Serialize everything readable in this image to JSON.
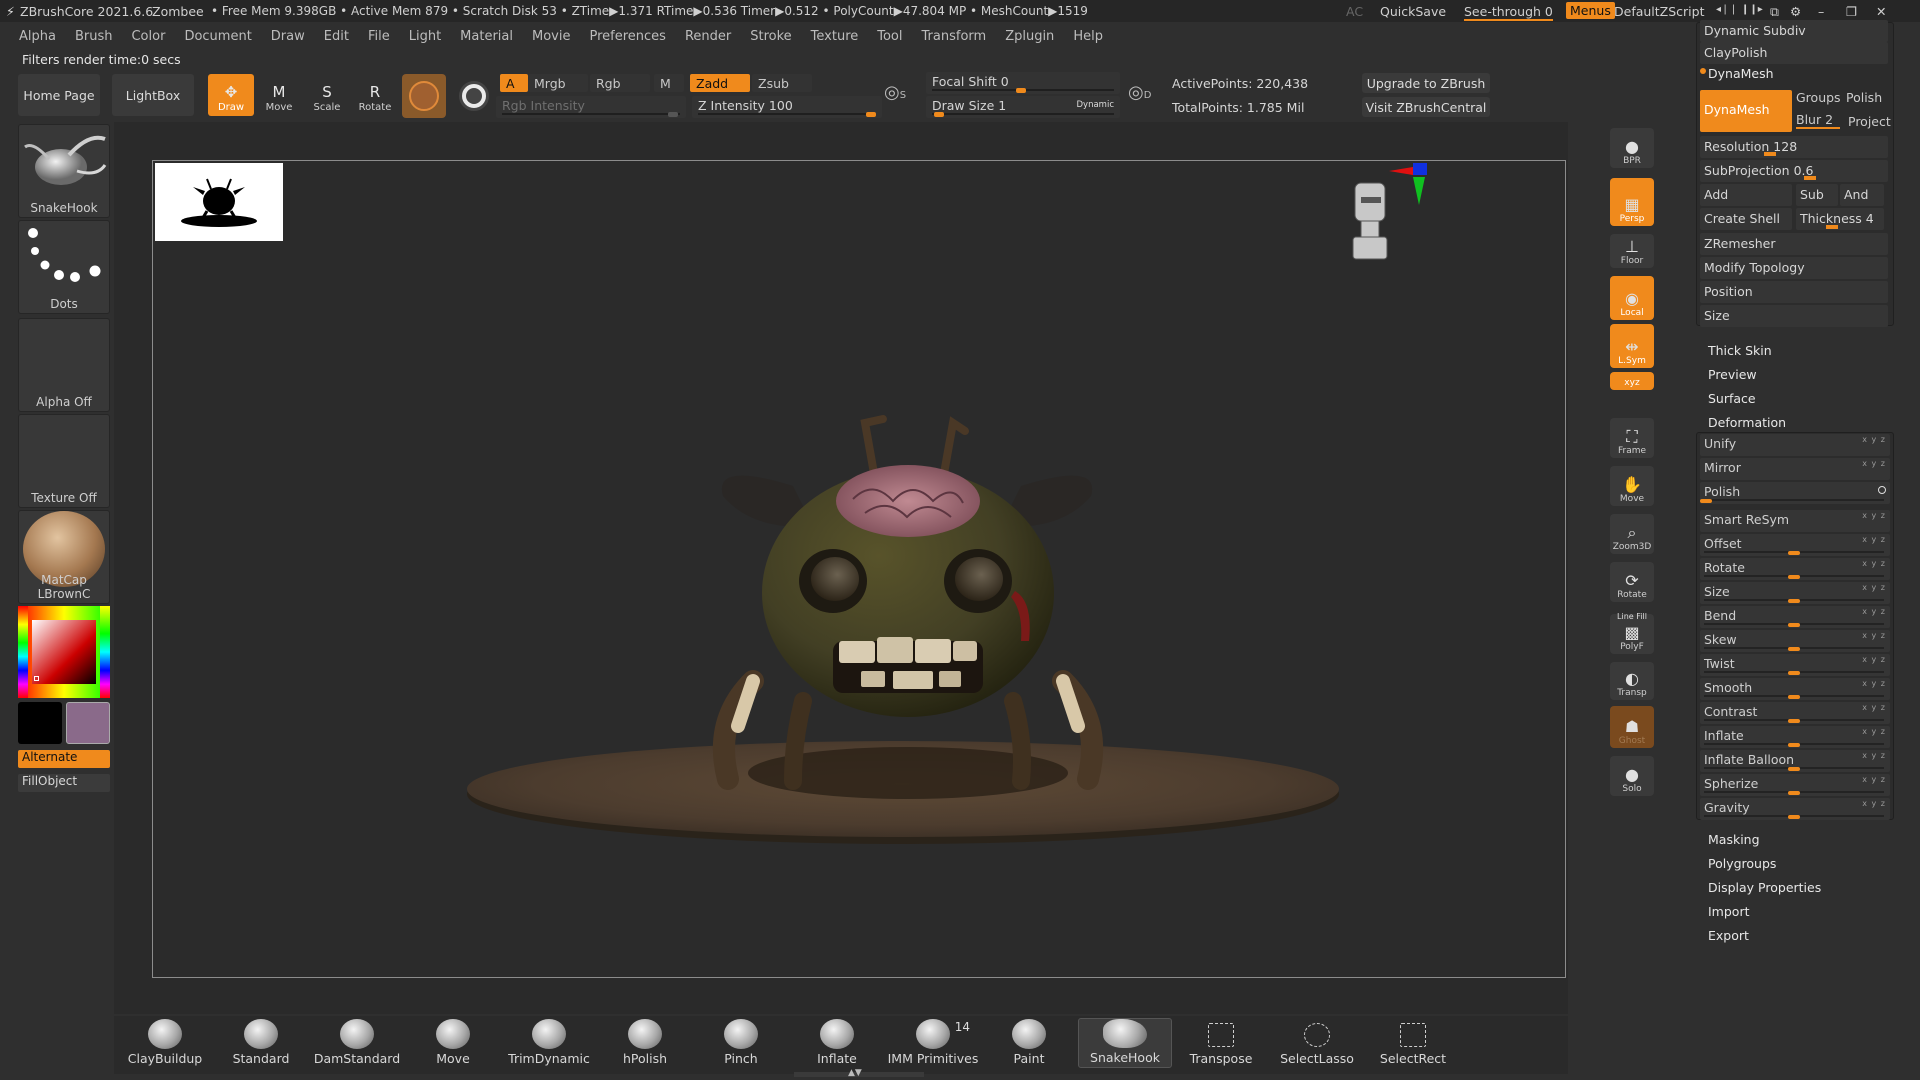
{
  "titlebar": {
    "app": "ZBrushCore 2021.6.6",
    "project": "Zombee",
    "stats": "• Free Mem 9.398GB • Active Mem 879 • Scratch Disk 53 • ZTime▶1.371 RTime▶0.536 Timer▶0.512 • PolyCount▶47.804 MP • MeshCount▶1519",
    "ac": "AC",
    "quicksave": "QuickSave",
    "seethrough": "See-through  0",
    "menus": "Menus",
    "script": "DefaultZScript"
  },
  "menu": [
    "Alpha",
    "Brush",
    "Color",
    "Document",
    "Draw",
    "Edit",
    "File",
    "Light",
    "Material",
    "Movie",
    "Preferences",
    "Render",
    "Stroke",
    "Texture",
    "Tool",
    "Transform",
    "Zplugin",
    "Help"
  ],
  "notice": "Filters render time:0 secs",
  "toolbar": {
    "home": "Home Page",
    "lightbox": "LightBox",
    "tools": [
      {
        "icon": "draw-icon",
        "glyph": "✥",
        "label": "Draw",
        "on": true
      },
      {
        "icon": "move-icon",
        "glyph": "M",
        "label": "Move",
        "on": false
      },
      {
        "icon": "scale-icon",
        "glyph": "S",
        "label": "Scale",
        "on": false
      },
      {
        "icon": "rotate-icon",
        "glyph": "R",
        "label": "Rotate",
        "on": false
      }
    ],
    "a": "A",
    "mrgb": "Mrgb",
    "rgb": "Rgb",
    "m": "M",
    "rgb_intensity": "Rgb Intensity",
    "zadd": "Zadd",
    "zsub": "Zsub",
    "z_intensity": "Z Intensity 100",
    "z_intensity_value": 100,
    "focal_shift": "Focal Shift 0",
    "focal_shift_value": 0,
    "draw_size": "Draw Size 1",
    "draw_size_value": 1,
    "dynamic": "Dynamic",
    "s_label": "S",
    "d_label": "D",
    "active_points": "ActivePoints: 220,438",
    "total_points": "TotalPoints: 1.785 Mil",
    "upgrade": "Upgrade to ZBrush",
    "visit": "Visit ZBrushCentral"
  },
  "left_shelf": {
    "brush": "SnakeHook",
    "stroke": "Dots",
    "alpha": "Alpha Off",
    "texture": "Texture Off",
    "material": "MatCap LBrownC",
    "alternate": "Alternate",
    "fillobject": "FillObject",
    "colors": {
      "primary": "#000000",
      "secondary": "#8a6a8a"
    }
  },
  "right_shelf": [
    {
      "label": "BPR",
      "icon": "bpr-icon",
      "glyph": "●",
      "on": false
    },
    {
      "label": "Persp",
      "icon": "perspective-icon",
      "glyph": "▦",
      "on": true
    },
    {
      "label": "Floor",
      "icon": "floor-icon",
      "glyph": "⊥",
      "on": false
    },
    {
      "label": "Local",
      "icon": "local-icon",
      "glyph": "◉",
      "on": true
    },
    {
      "label": "L.Sym",
      "icon": "local-symmetry-icon",
      "glyph": "⇹",
      "on": true
    },
    {
      "label": "xyz",
      "icon": "xyz-icon",
      "glyph": "",
      "on": true
    },
    {
      "label": "Frame",
      "icon": "frame-icon",
      "glyph": "⛶",
      "on": false
    },
    {
      "label": "Move",
      "icon": "hand-icon",
      "glyph": "✋",
      "on": false
    },
    {
      "label": "Zoom3D",
      "icon": "zoom-icon",
      "glyph": "⌕",
      "on": false
    },
    {
      "label": "Rotate",
      "icon": "rotate-view-icon",
      "glyph": "⟳",
      "on": false
    },
    {
      "label": "PolyF",
      "icon": "polyframe-icon",
      "glyph": "▩",
      "on": false
    },
    {
      "label": "Transp",
      "icon": "transparency-icon",
      "glyph": "◐",
      "on": false
    },
    {
      "label": "Ghost",
      "icon": "ghost-icon",
      "glyph": "☗",
      "on": false
    },
    {
      "label": "Solo",
      "icon": "solo-icon",
      "glyph": "●",
      "on": false
    }
  ],
  "line_fill": "Line Fill",
  "palette": {
    "dynamic_subdiv": "Dynamic Subdiv",
    "claypolish": "ClayPolish",
    "dynamesh_header": "DynaMesh",
    "dynamesh_button": "DynaMesh",
    "groups": "Groups",
    "polish": "Polish",
    "blur": "Blur 2",
    "project": "Project",
    "resolution": "Resolution 128",
    "subprojection": "SubProjection 0.6",
    "add": "Add",
    "sub": "Sub",
    "and": "And",
    "create_shell": "Create Shell",
    "thickness": "Thickness 4",
    "zremesher": "ZRemesher",
    "modify_topology": "Modify Topology",
    "position": "Position",
    "size": "Size",
    "thick_skin": "Thick Skin",
    "preview": "Preview",
    "surface": "Surface",
    "deformation": "Deformation",
    "deform_items": [
      "Unify",
      "Mirror",
      "Polish",
      "Smart ReSym",
      "Offset",
      "Rotate",
      "Size",
      "Bend",
      "Skew",
      "Twist",
      "Smooth",
      "Contrast",
      "Inflate",
      "Inflate Balloon",
      "Spherize",
      "Gravity"
    ],
    "masking": "Masking",
    "polygroups": "Polygroups",
    "display_properties": "Display Properties",
    "import": "Import",
    "export": "Export"
  },
  "bottom_shelf": [
    {
      "label": "ClayBuildup",
      "icon": "claybuildup-brush-icon"
    },
    {
      "label": "Standard",
      "icon": "standard-brush-icon"
    },
    {
      "label": "DamStandard",
      "icon": "damstandard-brush-icon"
    },
    {
      "label": "Move",
      "icon": "move-brush-icon"
    },
    {
      "label": "TrimDynamic",
      "icon": "trimdynamic-brush-icon"
    },
    {
      "label": "hPolish",
      "icon": "hpolish-brush-icon"
    },
    {
      "label": "Pinch",
      "icon": "pinch-brush-icon"
    },
    {
      "label": "Inflate",
      "icon": "inflate-brush-icon"
    },
    {
      "label": "IMM Primitives",
      "icon": "imm-primitives-icon",
      "badge": "14"
    },
    {
      "label": "Paint",
      "icon": "paint-brush-icon"
    },
    {
      "label": "SnakeHook",
      "icon": "snakehook-brush-icon",
      "selected": true
    },
    {
      "label": "Transpose",
      "icon": "transpose-icon"
    },
    {
      "label": "SelectLasso",
      "icon": "selectlasso-icon"
    },
    {
      "label": "SelectRect",
      "icon": "selectrect-icon"
    }
  ],
  "colors": {
    "accent": "#f08a1c",
    "panel": "#2c2c2c",
    "canvas": "#2b2b2b"
  }
}
